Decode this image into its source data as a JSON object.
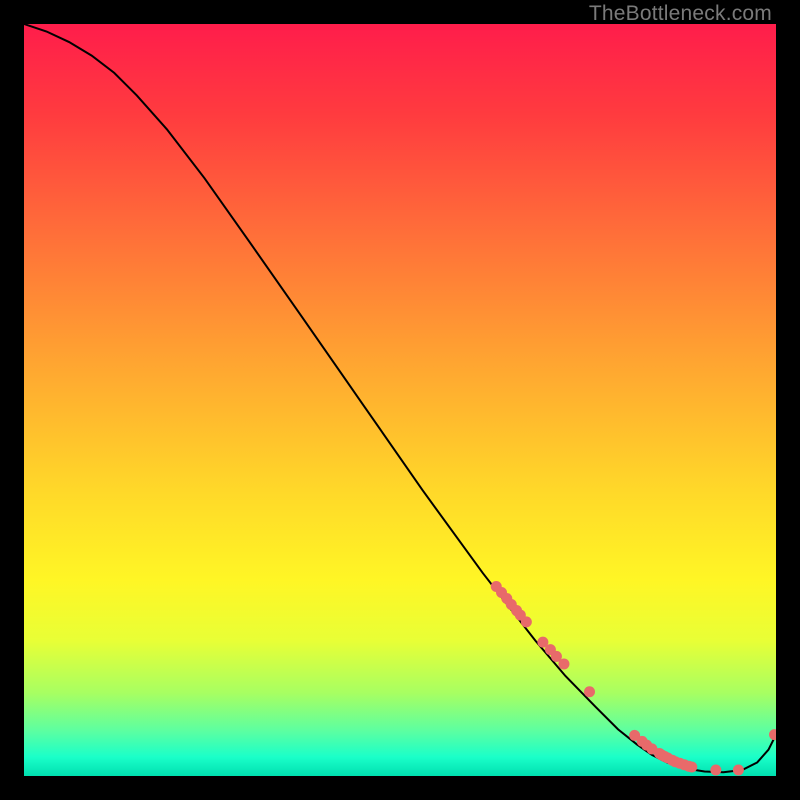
{
  "watermark": "TheBottleneck.com",
  "chart_data": {
    "type": "line",
    "title": "",
    "xlabel": "",
    "ylabel": "",
    "xlim": [
      0,
      1
    ],
    "ylim": [
      0,
      1
    ],
    "grid": false,
    "legend": false,
    "background_gradient": {
      "type": "vertical",
      "stops": [
        {
          "t": 0.0,
          "color": "#ff1d4b"
        },
        {
          "t": 0.12,
          "color": "#ff3b3f"
        },
        {
          "t": 0.28,
          "color": "#ff6f39"
        },
        {
          "t": 0.45,
          "color": "#ffa531"
        },
        {
          "t": 0.62,
          "color": "#ffd829"
        },
        {
          "t": 0.74,
          "color": "#fff625"
        },
        {
          "t": 0.82,
          "color": "#e8ff36"
        },
        {
          "t": 0.89,
          "color": "#a7ff62"
        },
        {
          "t": 0.94,
          "color": "#5cffa1"
        },
        {
          "t": 0.975,
          "color": "#1affc9"
        },
        {
          "t": 1.0,
          "color": "#00dfb0"
        }
      ]
    },
    "series": [
      {
        "name": "curve",
        "color": "#000000",
        "stroke_width": 2,
        "x": [
          0.0,
          0.03,
          0.06,
          0.09,
          0.12,
          0.15,
          0.19,
          0.24,
          0.3,
          0.37,
          0.45,
          0.53,
          0.61,
          0.68,
          0.72,
          0.76,
          0.79,
          0.815,
          0.835,
          0.855,
          0.88,
          0.905,
          0.93,
          0.955,
          0.975,
          0.99,
          1.0
        ],
        "y": [
          1.0,
          0.99,
          0.976,
          0.958,
          0.935,
          0.905,
          0.86,
          0.795,
          0.71,
          0.61,
          0.495,
          0.38,
          0.27,
          0.18,
          0.133,
          0.092,
          0.062,
          0.042,
          0.028,
          0.018,
          0.01,
          0.006,
          0.005,
          0.008,
          0.018,
          0.035,
          0.055
        ]
      }
    ],
    "scatter": {
      "name": "points",
      "color": "#e86a6a",
      "radius": 5.5,
      "x": [
        0.628,
        0.635,
        0.642,
        0.648,
        0.655,
        0.66,
        0.668,
        0.69,
        0.7,
        0.708,
        0.718,
        0.752,
        0.812,
        0.822,
        0.828,
        0.835,
        0.845,
        0.848,
        0.852,
        0.856,
        0.862,
        0.866,
        0.872,
        0.878,
        0.884,
        0.888,
        0.92,
        0.95,
        0.998
      ],
      "y": [
        0.252,
        0.244,
        0.236,
        0.228,
        0.22,
        0.214,
        0.205,
        0.178,
        0.168,
        0.159,
        0.149,
        0.112,
        0.054,
        0.046,
        0.041,
        0.036,
        0.03,
        0.028,
        0.026,
        0.024,
        0.021,
        0.019,
        0.017,
        0.015,
        0.013,
        0.012,
        0.008,
        0.008,
        0.055
      ]
    }
  }
}
